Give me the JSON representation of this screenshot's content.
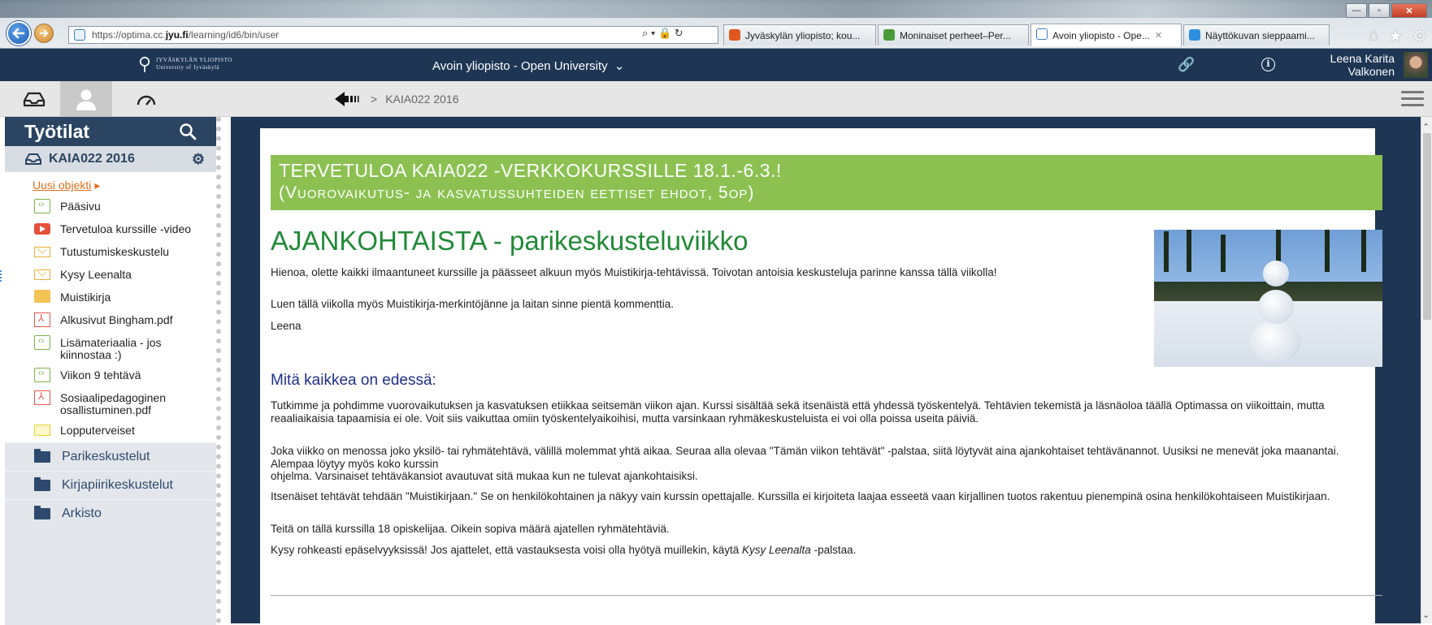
{
  "browser": {
    "url_prefix": "https://optima.cc.",
    "url_domain": "jyu.fi",
    "url_path": "/learning/id6/bin/user",
    "tools": "⌕ ▾ 🔒 ↻",
    "tabs": [
      {
        "label": "Jyväskylän yliopisto; kou...",
        "color": "#e0581f"
      },
      {
        "label": "Moninaiset perheet–Per...",
        "color": "#4a9a3a"
      },
      {
        "label": "Avoin yliopisto - Ope...",
        "color": "#3a7bc2"
      },
      {
        "label": "Näyttökuvan sieppaami...",
        "color": "#2d8fe0"
      }
    ],
    "tab_close": "✕",
    "window_controls": {
      "minimize": "—",
      "maximize": "▫",
      "close": "✕"
    },
    "icons": {
      "home": "⌂",
      "star": "★",
      "gear": "⚙"
    }
  },
  "header": {
    "logo_line1": "JYVÄSKYLÄN YLIOPISTO",
    "logo_line2": "University of Jyväskylä",
    "title": "Avoin yliopisto - Open University",
    "title_chevron": "⌄",
    "link_icon": "🔗",
    "info_icon": "i",
    "user_first": "Leena Karita",
    "user_last": "Valkonen"
  },
  "toolbar": {
    "breadcrumb_sep": ">",
    "breadcrumb_current": "KAIA022 2016"
  },
  "sidebar": {
    "title": "Työtilat",
    "search_icon": "⚲",
    "course_name": "KAIA022 2016",
    "settings_icon": "⚙",
    "new_object": "Uusi objekti",
    "new_object_arrow": "▸",
    "items": [
      {
        "label": "Pääsivu",
        "icon": "page-icon"
      },
      {
        "label": "Tervetuloa kurssille -video",
        "icon": "video-icon"
      },
      {
        "label": "Tutustumiskeskustelu",
        "icon": "mail-icon"
      },
      {
        "label": "Kysy Leenalta",
        "icon": "mail-icon"
      },
      {
        "label": "Muistikirja",
        "icon": "notebook-icon"
      },
      {
        "label": "Alkusivut Bingham.pdf",
        "icon": "pdf-icon"
      },
      {
        "label": "Lisämateriaalia - jos kiinnostaa :)",
        "icon": "page-icon"
      },
      {
        "label": "Viikon 9 tehtävä",
        "icon": "page-icon"
      },
      {
        "label": "Sosiaalipedagoginen osallistuminen.pdf",
        "icon": "pdf-icon"
      },
      {
        "label": "Lopputerveiset",
        "icon": "mail-icon"
      }
    ],
    "folders": [
      "Parikeskustelut",
      "Kirjapiirikeskustelut",
      "Arkisto"
    ]
  },
  "content": {
    "banner_line1": "TERVETULOA KAIA022 -VERKKOKURSSILLE 18.1.-6.3.!",
    "banner_line2": "(Vuorovaikutus- ja kasvatussuhteiden eettiset ehdot, 5op)",
    "news_title": "AJANKOHTAISTA - parikeskusteluviikko",
    "p1": "Hienoa, olette kaikki ilmaantuneet kurssille ja päässeet alkuun myös Muistikirja-tehtävissä. Toivotan antoisia keskusteluja parinne kanssa tällä viikolla!",
    "p2": "Luen tällä viikolla myös Muistikirja-merkintöjänne ja laitan sinne pientä kommenttia.",
    "p3": "Leena",
    "sub_title": "Mitä kaikkea on edessä:",
    "p4": "Tutkimme ja pohdimme vuorovaikutuksen ja kasvatuksen etiikkaa seitsemän viikon ajan. Kurssi sisältää sekä itsenäistä että yhdessä työskentelyä. Tehtävien tekemistä ja läsnäoloa täällä Optimassa on viikoittain, mutta reaaliaikaisia tapaamisia ei ole. Voit siis vaikuttaa omiin työskentelyaikoihisi, mutta varsinkaan ryhmäkeskusteluista ei voi olla poissa useita päiviä.",
    "p5a": "Joka viikko on menossa joko yksilö- tai ryhmätehtävä, välillä molemmat yhtä aikaa. Seuraa alla olevaa \"Tämän viikon tehtävät\" -palstaa, siitä löytyvät aina ajankohtaiset tehtävänannot. Uusiksi ne menevät joka maanantai. Alempaa löytyy myös koko kurssin",
    "p5b": "ohjelma. Varsinaiset tehtäväkansiot avautuvat sitä mukaa kun ne tulevat ajankohtaisiksi.",
    "p6": "Itsenäiset tehtävät tehdään \"Muistikirjaan.\" Se on henkilökohtainen ja näkyy vain kurssin opettajalle. Kurssilla ei kirjoiteta laajaa esseetä vaan kirjallinen tuotos rakentuu pienempinä osina henkilökohtaiseen Muistikirjaan.",
    "p7": "Teitä on tällä kurssilla 18 opiskelijaa. Oikein sopiva määrä ajatellen ryhmätehtäviä.",
    "p8_before": "Kysy rohkeasti epäselvyyksissä! Jos ajattelet, että vastauksesta voisi olla hyötyä muillekin, käytä ",
    "p8_italic": "Kysy Leenalta",
    "p8_after": " -palstaa."
  },
  "colors": {
    "header_bg": "#1e3654",
    "banner_green": "#8cc152",
    "title_green": "#218a38",
    "subtitle_blue": "#1f2f8a",
    "link_orange": "#e0701e"
  }
}
